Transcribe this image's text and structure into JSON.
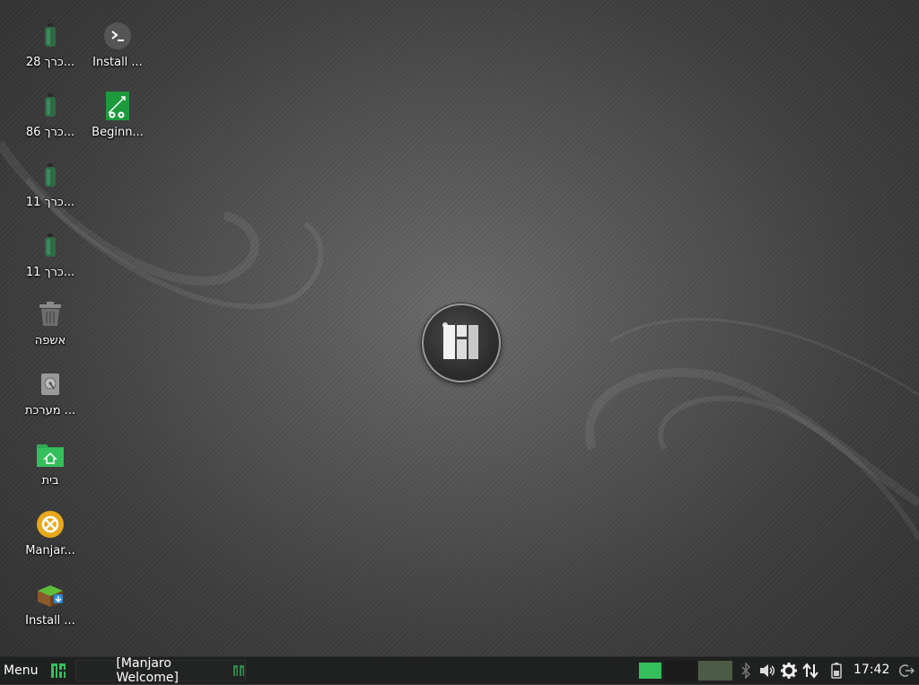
{
  "desktop": {
    "icons": [
      {
        "label": "כרך 28...",
        "icon": "usb-drive-icon"
      },
      {
        "label": "כרך 86...",
        "icon": "usb-drive-icon"
      },
      {
        "label": "כרך 11...",
        "icon": "usb-drive-icon"
      },
      {
        "label": "כרך 11...",
        "icon": "usb-drive-icon"
      },
      {
        "label": "אשפה",
        "icon": "trash-icon"
      },
      {
        "label": "מערכת ...",
        "icon": "filesystem-icon"
      },
      {
        "label": "בית",
        "icon": "home-folder-icon"
      },
      {
        "label": "Manjar...",
        "icon": "manjaro-welcome-icon"
      },
      {
        "label": "Install ...",
        "icon": "package-install-icon"
      },
      {
        "label": "Install ...",
        "icon": "terminal-icon"
      },
      {
        "label": "Beginn...",
        "icon": "beginner-guide-icon"
      }
    ]
  },
  "taskbar": {
    "menu_label": "Menu",
    "window_label": "[Manjaro Welcome]",
    "clock": "17:42"
  },
  "colors": {
    "accent_green": "#35bf5c",
    "workspace_active": "#4d5a45",
    "taskbar_bg": "#1f2120"
  }
}
